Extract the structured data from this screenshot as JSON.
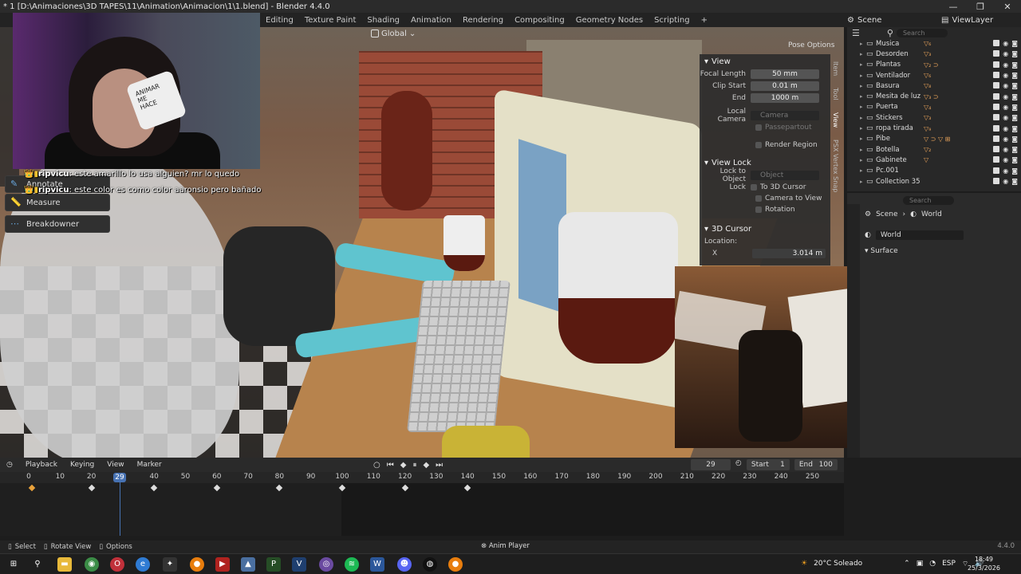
{
  "window": {
    "title": "* 1 [D:\\Animaciones\\3D TAPES\\11\\Animation\\Animacion\\1\\1.blend] - Blender 4.4.0",
    "controls": [
      "—",
      "❐",
      "✕"
    ]
  },
  "workspace_tabs": [
    "Editing",
    "Texture Paint",
    "Shading",
    "Animation",
    "Rendering",
    "Compositing",
    "Geometry Nodes",
    "Scripting",
    "+"
  ],
  "scene": {
    "label": "Scene",
    "view_layer": "ViewLayer"
  },
  "viewport": {
    "orientation": "Global",
    "pose_options": "Pose Options"
  },
  "tools": [
    {
      "label": "Annotate",
      "icon": "annotate-icon"
    },
    {
      "label": "Measure",
      "icon": "measure-icon"
    },
    {
      "label": "Breakdowner",
      "icon": "breakdowner-icon"
    }
  ],
  "webcam": {
    "mug_text": "ANIMAR\nME\nHACE"
  },
  "chat": [
    {
      "user": "ripvicu",
      "text": ": este amarillo lo usa alguien? mr lo quedo"
    },
    {
      "user": "ripvicu",
      "text": ": este color es como color aaronsio pero bañado"
    }
  ],
  "npanel": {
    "view_section": "View",
    "focal_length": {
      "label": "Focal Length",
      "value": "50 mm"
    },
    "clip_start": {
      "label": "Clip Start",
      "value": "0.01 m"
    },
    "clip_end": {
      "label": "End",
      "value": "1000 m"
    },
    "local_camera": {
      "label": "Local Camera",
      "value": "Camera"
    },
    "passepartout": "Passepartout",
    "render_region": "Render Region",
    "view_lock_section": "View Lock",
    "lock_to_object": {
      "label": "Lock to Object",
      "placeholder": "Object"
    },
    "lock_label": "Lock",
    "lock_options": [
      "To 3D Cursor",
      "Camera to View",
      "Rotation"
    ],
    "cursor_section": "3D Cursor",
    "location_label": "Location:",
    "x": {
      "label": "X",
      "value": "3.014 m"
    },
    "side_tabs": [
      "Item",
      "Tool",
      "View",
      "PSX Vertex Snap"
    ]
  },
  "outliner": {
    "search_placeholder": "Search",
    "items": [
      {
        "name": "Musica",
        "tail": "▽₆"
      },
      {
        "name": "Desorden",
        "tail": "▽₃"
      },
      {
        "name": "Plantas",
        "tail": "▽₂ ⊃"
      },
      {
        "name": "Ventilador",
        "tail": "▽₆"
      },
      {
        "name": "Basura",
        "tail": "▽₈"
      },
      {
        "name": "Mesita de luz",
        "tail": "▽₃ ⊃"
      },
      {
        "name": "Puerta",
        "tail": "▽₄"
      },
      {
        "name": "Stickers",
        "tail": "▽₃"
      },
      {
        "name": "ropa tirada",
        "tail": "▽₉"
      },
      {
        "name": "Pibe",
        "tail": "▽ ⊃ ▽ ⊞"
      },
      {
        "name": "Botella",
        "tail": "▽₂"
      },
      {
        "name": "Gabinete",
        "tail": "▽"
      },
      {
        "name": "Pc.001",
        "tail": ""
      },
      {
        "name": "Collection 35",
        "tail": ""
      }
    ]
  },
  "properties": {
    "search_placeholder": "Search",
    "breadcrumb": [
      "Scene",
      "World"
    ],
    "world_name": "World",
    "surface_label": "Surface"
  },
  "timeline": {
    "menus": [
      "Playback",
      "Keying",
      "View",
      "Marker"
    ],
    "current_frame": "29",
    "start_label": "Start",
    "start": "1",
    "end_label": "End",
    "end": "100",
    "ruler_ticks": [
      0,
      10,
      20,
      30,
      40,
      50,
      60,
      70,
      80,
      90,
      100,
      110,
      120,
      130,
      140,
      150,
      160,
      170,
      180,
      190,
      200,
      210,
      220,
      230,
      240,
      250
    ],
    "playhead_frame": 29,
    "keyframes": [
      1,
      20,
      40,
      60,
      80,
      100,
      120,
      140
    ],
    "selected_keyframe": 1
  },
  "statusbar": {
    "items": [
      "Select",
      "Rotate View",
      "Options"
    ],
    "anim_player": "Anim Player",
    "version": "4.4.0"
  },
  "taskbar": {
    "weather": "20°C Soleado",
    "language": "ESP",
    "time": "18:49",
    "date": "25/3/2026"
  }
}
